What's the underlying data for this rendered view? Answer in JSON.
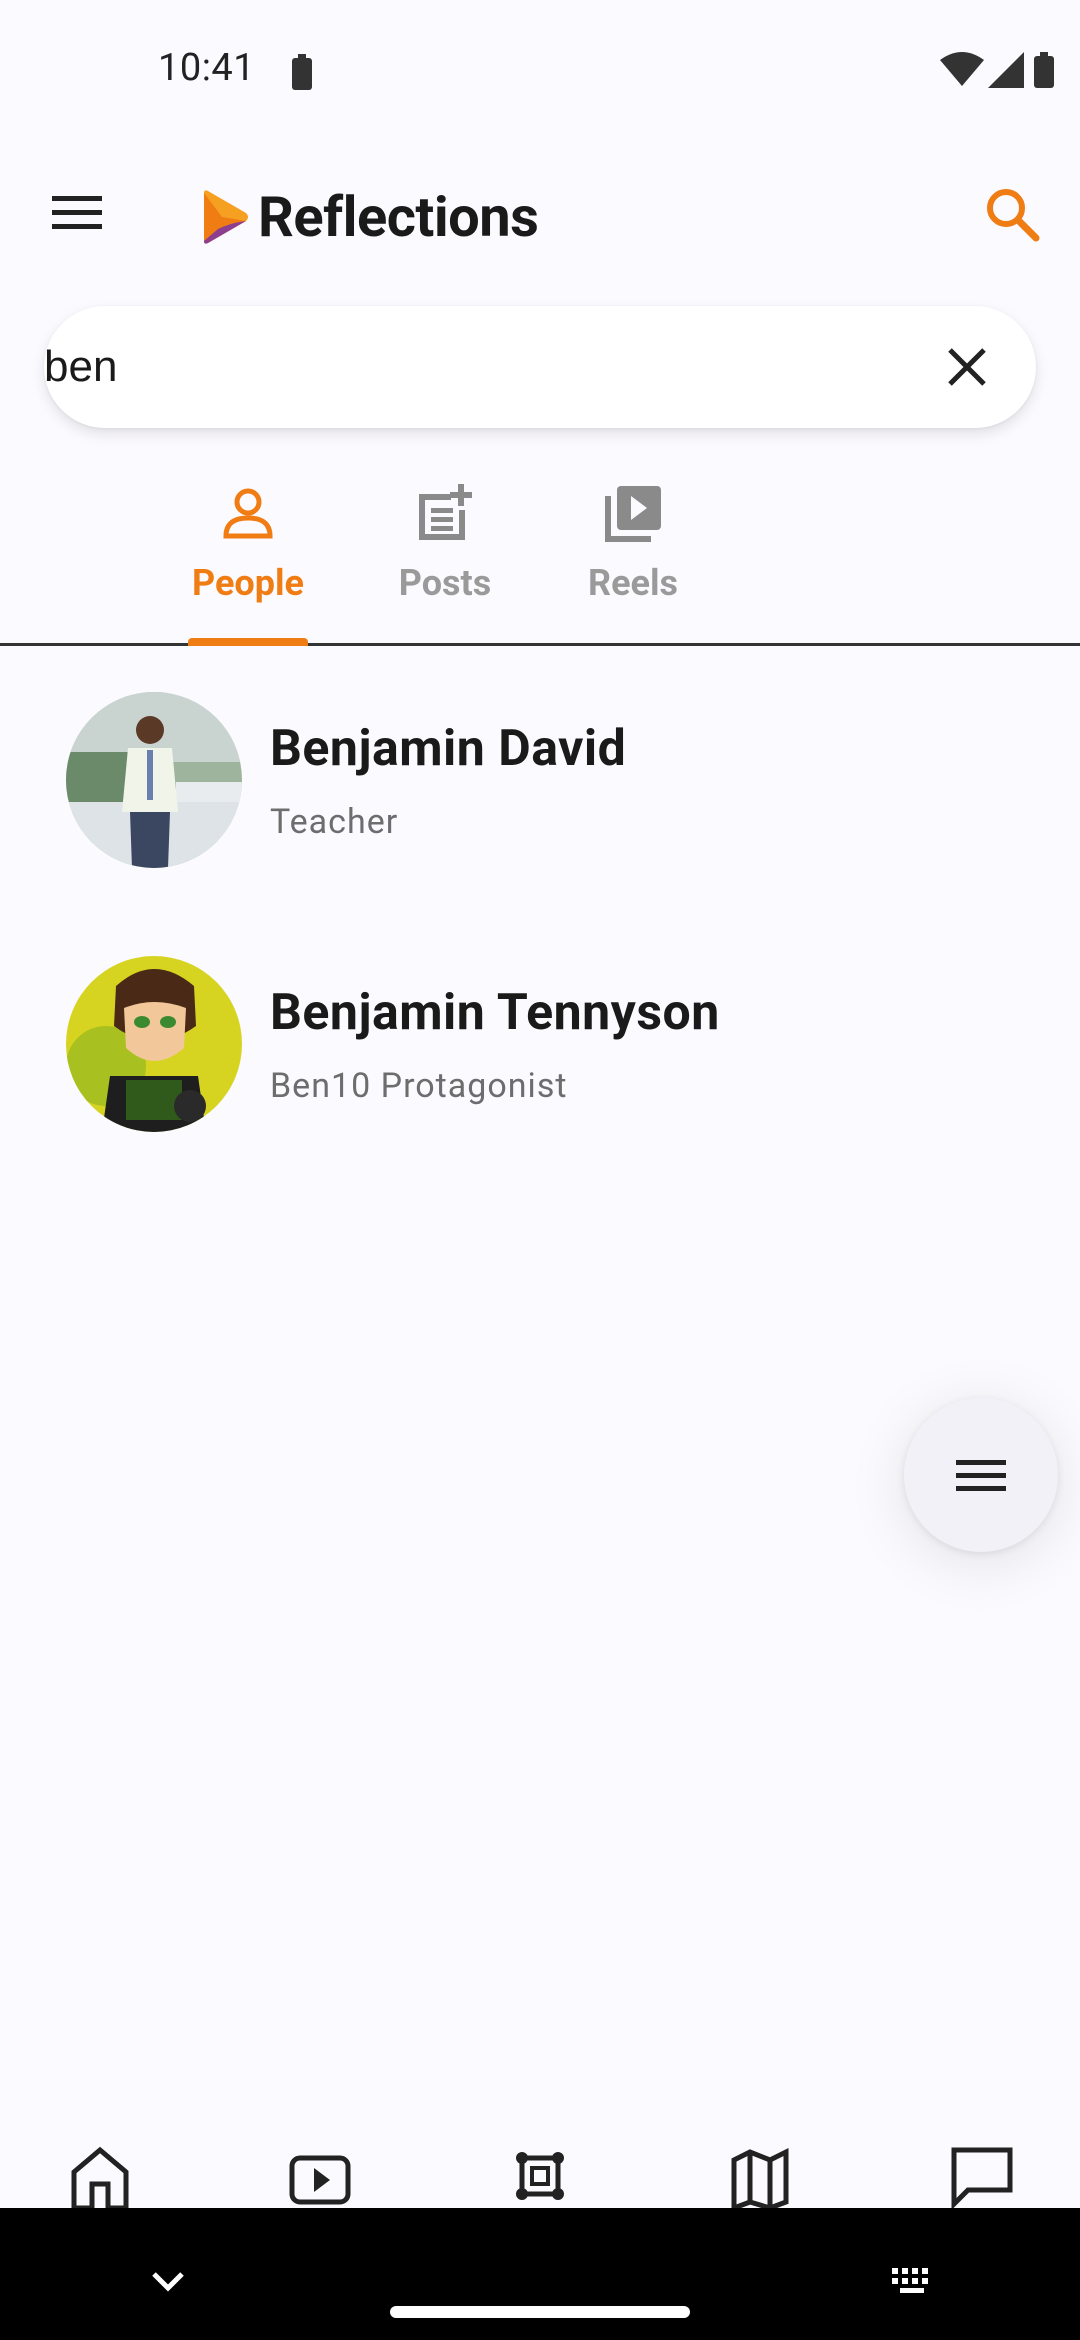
{
  "status_bar": {
    "time": "10:41"
  },
  "app_bar": {
    "title": "Reflections"
  },
  "search": {
    "query": "ben",
    "placeholder": ""
  },
  "tabs": [
    {
      "label": "People",
      "icon": "person-icon",
      "active": true
    },
    {
      "label": "Posts",
      "icon": "post-add-icon",
      "active": false
    },
    {
      "label": "Reels",
      "icon": "video-library-icon",
      "active": false
    }
  ],
  "results": [
    {
      "name": "Benjamin David",
      "subtitle": "Teacher"
    },
    {
      "name": "Benjamin Tennyson",
      "subtitle": "Ben10 Protagonist"
    }
  ],
  "bottom_nav": [
    "home-icon",
    "play-icon",
    "scan-icon",
    "map-icon",
    "chat-icon"
  ],
  "colors": {
    "accent": "#f07c14",
    "background": "#fbfaff",
    "logo_purple": "#8e3e8e"
  }
}
